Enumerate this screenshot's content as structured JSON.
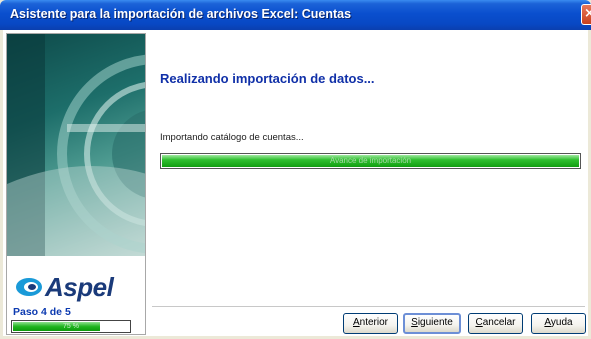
{
  "window": {
    "title": "Asistente para la importación de archivos Excel: Cuentas"
  },
  "sidebar": {
    "logo_text": "Aspel",
    "step_label": "Paso 4 de 5",
    "step_progress_label": "75 %",
    "step_progress_fraction": 0.75
  },
  "main": {
    "heading": "Realizando importación de datos...",
    "status_text": "Importando catálogo de cuentas...",
    "progress_label": "Avance de importación",
    "progress_fraction": 1.0
  },
  "buttons": {
    "back": {
      "first": "A",
      "rest": "nterior"
    },
    "next": {
      "first": "S",
      "rest": "iguiente"
    },
    "cancel": {
      "first": "C",
      "rest": "ancelar"
    },
    "help": {
      "first": "A",
      "rest": "yuda"
    }
  }
}
